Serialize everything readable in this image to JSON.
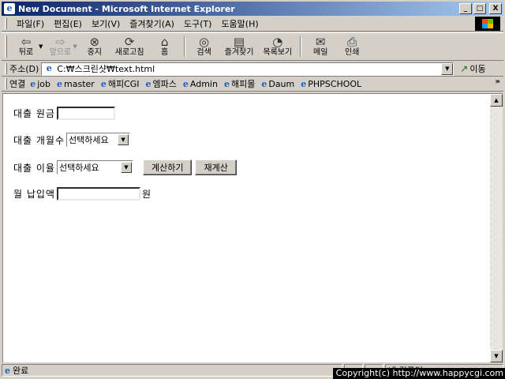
{
  "window": {
    "title": "New Document - Microsoft Internet Explorer",
    "minimize": "_",
    "maximize": "□",
    "close": "X"
  },
  "menu": {
    "items": [
      "파일(F)",
      "편집(E)",
      "보기(V)",
      "즐겨찾기(A)",
      "도구(T)",
      "도움말(H)"
    ]
  },
  "toolbar": {
    "back": "뒤로",
    "forward": "앞으로",
    "stop": "중지",
    "refresh": "새로고침",
    "home": "홈",
    "search": "검색",
    "favorites": "즐겨찾기",
    "history": "목록보기",
    "mail": "메일",
    "print": "인쇄",
    "icons": {
      "back": "back-arrow-icon",
      "forward": "forward-arrow-icon",
      "stop": "stop-icon",
      "refresh": "refresh-icon",
      "home": "home-icon",
      "search": "search-icon",
      "favorites": "favorites-icon",
      "history": "history-icon",
      "mail": "mail-icon",
      "print": "print-icon"
    }
  },
  "address": {
    "label": "주소(D)",
    "value": "C:₩스크린샷₩text.html",
    "go": "이동"
  },
  "links": {
    "label": "연결",
    "items": [
      "job",
      "master",
      "해피CGI",
      "엠파스",
      "Admin",
      "해피몰",
      "Daum",
      "PHPSCHOOL"
    ],
    "more": "»"
  },
  "form": {
    "principal_label": "대출 원금",
    "principal_value": "",
    "months_label": "대출 개월수",
    "months_selected": "선택하세요",
    "rate_label": "대출 이율",
    "rate_selected": "선택하세요",
    "calc_button": "계산하기",
    "reset_button": "재계산",
    "monthly_label": "월 납입액",
    "monthly_value": "",
    "monthly_unit": "원"
  },
  "status": {
    "text": "완료",
    "zone": "내 컴퓨터"
  },
  "overlay": {
    "copyright": "Copyright(c) http://www.happycgi.com"
  },
  "colors": {
    "titlebar_start": "#0a246a",
    "titlebar_end": "#a6caf0",
    "chrome": "#d4d0c8"
  }
}
